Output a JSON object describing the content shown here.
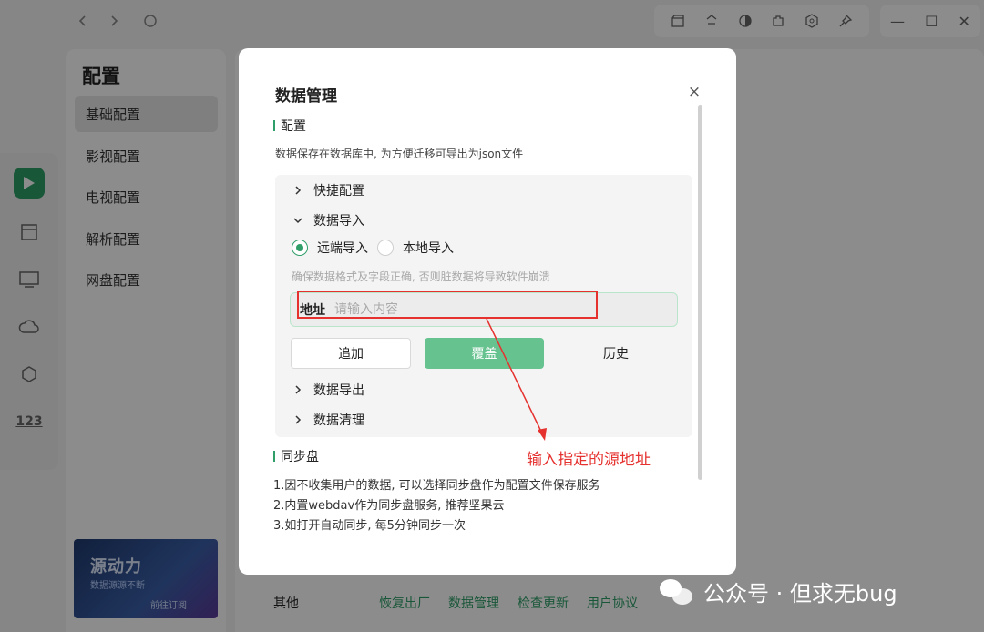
{
  "app": {
    "sidebar": {
      "title": "配置",
      "items": [
        {
          "label": "基础配置",
          "active": true
        },
        {
          "label": "影视配置",
          "active": false
        },
        {
          "label": "电视配置",
          "active": false
        },
        {
          "label": "解析配置",
          "active": false
        },
        {
          "label": "网盘配置",
          "active": false
        }
      ]
    },
    "promo": {
      "title": "源动力",
      "subtitle": "数据源源不断",
      "button": "前往订阅"
    },
    "bottom_bar": {
      "label": "其他",
      "links": [
        "恢复出厂",
        "数据管理",
        "检查更新",
        "用户协议"
      ]
    },
    "rail_icons": [
      "app-logo-icon",
      "film-icon",
      "tv-icon",
      "cloud-icon",
      "cube-icon",
      "numbers-icon"
    ],
    "toolbar_icons": [
      "clapperboard-icon",
      "recycle-icon",
      "theme-icon",
      "plugin-icon",
      "settings-icon",
      "pin-icon"
    ],
    "nav_icons": [
      "back-icon",
      "forward-icon",
      "refresh-icon"
    ],
    "window_controls": [
      "minimize-icon",
      "maximize-icon",
      "close-window-icon"
    ]
  },
  "modal": {
    "title": "数据管理",
    "close_symbol": "×",
    "config_section": {
      "heading": "配置",
      "description": "数据保存在数据库中, 为方便迁移可导出为json文件"
    },
    "panel": {
      "quick_config": "快捷配置",
      "data_import": "数据导入",
      "radio": {
        "remote": "远端导入",
        "local": "本地导入",
        "selected": "remote"
      },
      "hint": "确保数据格式及字段正确, 否则脏数据将导致软件崩溃",
      "address": {
        "label": "地址",
        "placeholder": "请输入内容",
        "value": ""
      },
      "buttons": {
        "add": "追加",
        "cover": "覆盖",
        "history": "历史"
      },
      "data_export": "数据导出",
      "data_clear": "数据清理"
    },
    "sync_section": {
      "heading": "同步盘",
      "lines": [
        "1.因不收集用户的数据, 可以选择同步盘作为配置文件保存服务",
        "2.内置webdav作为同步盘服务, 推荐坚果云",
        "3.如打开自动同步, 每5分钟同步一次"
      ]
    }
  },
  "annotation": {
    "text": "输入指定的源地址",
    "color": "#e5322f"
  },
  "watermark": {
    "text": "公众号 · 但求无bug"
  },
  "colors": {
    "accent": "#2f9e68",
    "cover_button": "#66c28f",
    "annotation": "#e5322f"
  }
}
